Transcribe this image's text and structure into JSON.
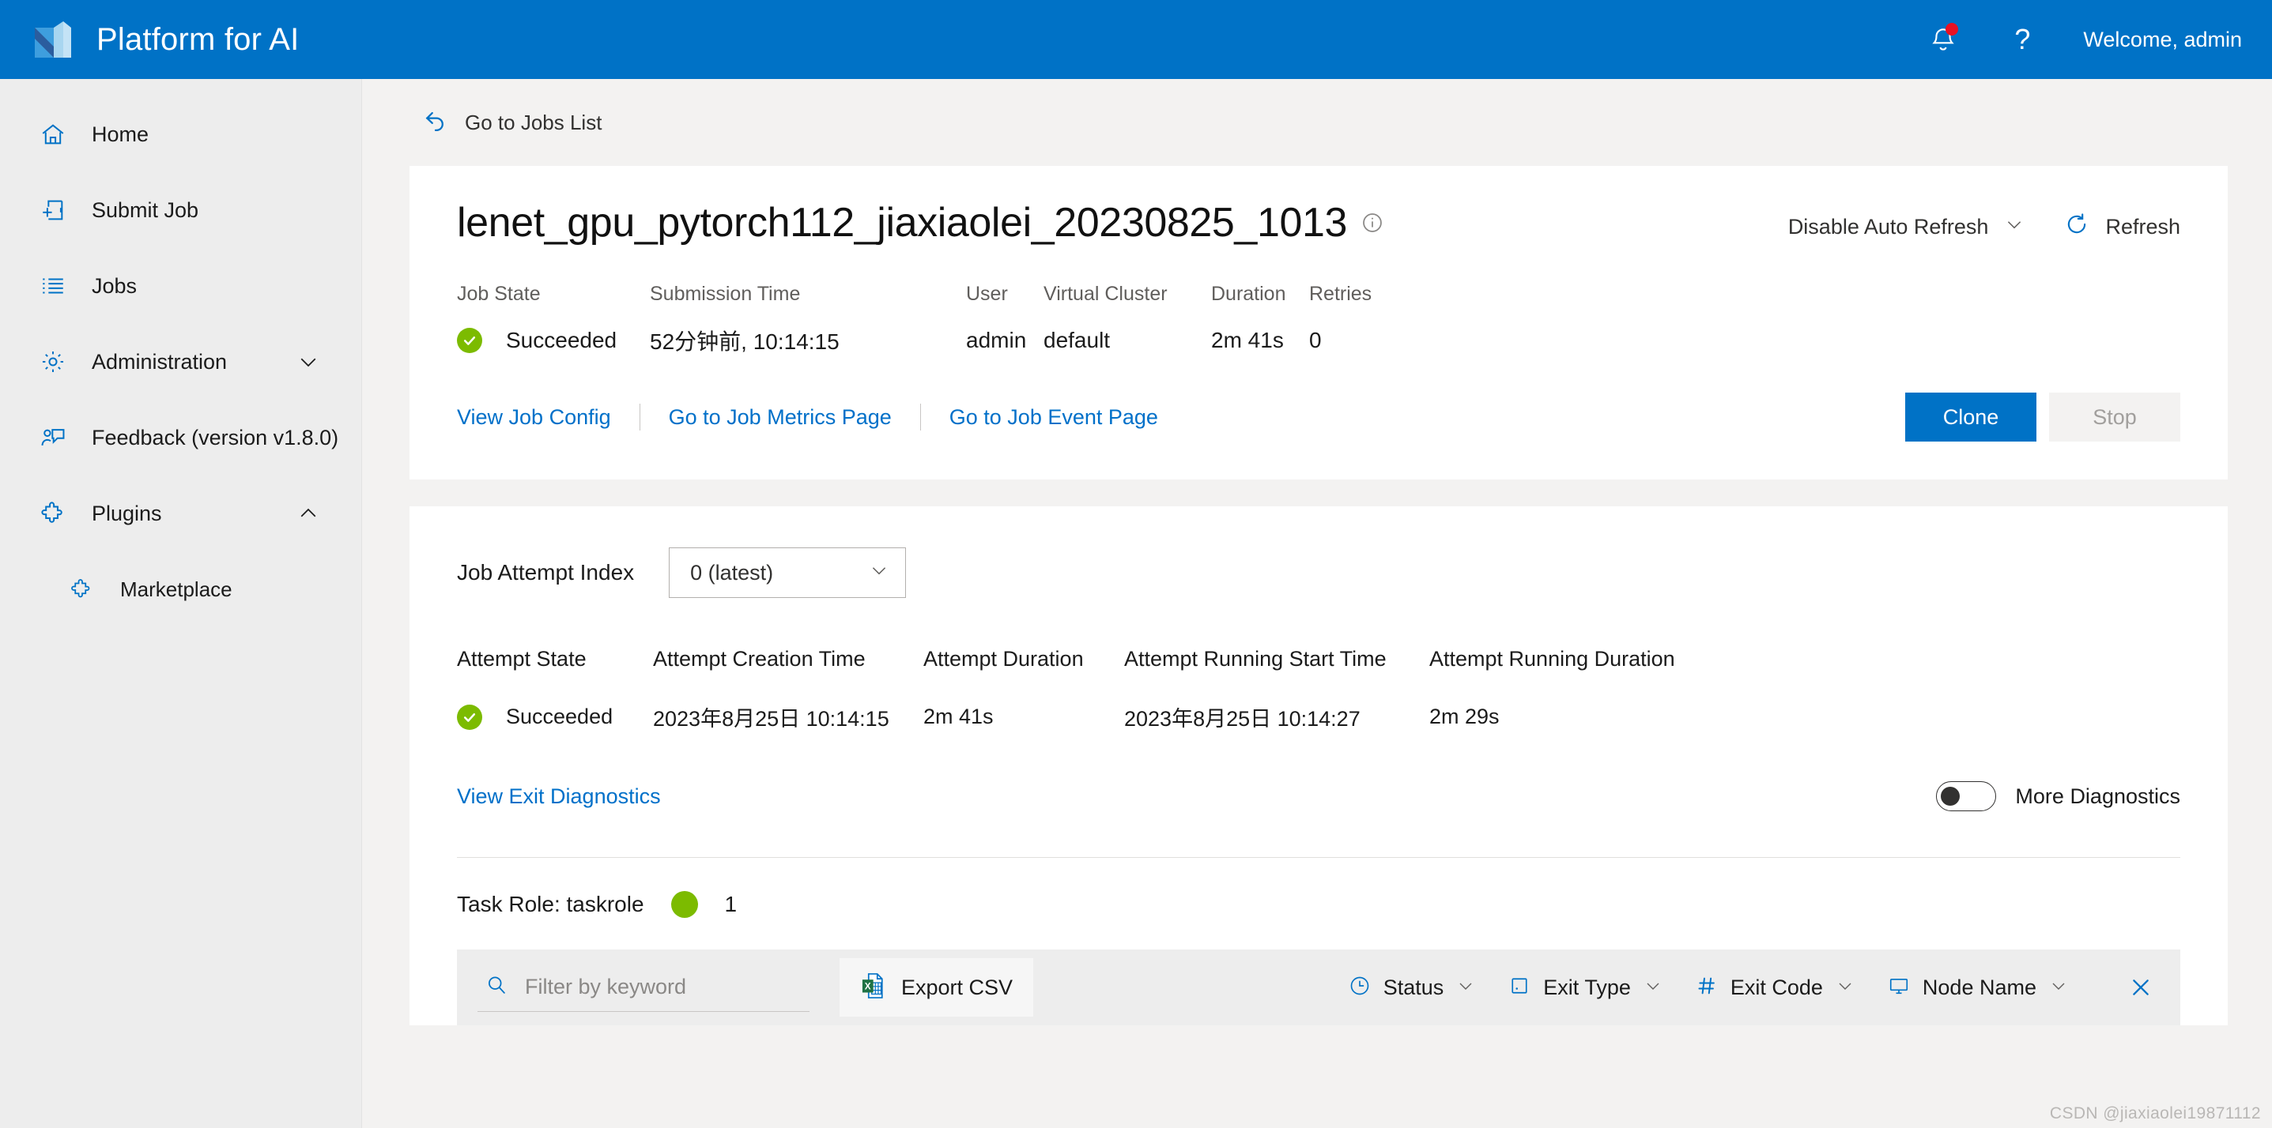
{
  "header": {
    "brand_title": "Platform for AI",
    "logo_name": "platform-logo",
    "notifications_icon": "bell-icon",
    "help_icon": "question-mark-icon",
    "welcome": "Welcome, admin",
    "accent_color": "#0072c6",
    "badge_color": "#e81123"
  },
  "sidebar": {
    "items": [
      {
        "label": "Home",
        "icon": "home-icon",
        "name": "home",
        "expandable": false,
        "sub": false
      },
      {
        "label": "Submit Job",
        "icon": "submit-job-icon",
        "name": "submit-job",
        "expandable": false,
        "sub": false
      },
      {
        "label": "Jobs",
        "icon": "jobs-list-icon",
        "name": "jobs",
        "expandable": false,
        "sub": false
      },
      {
        "label": "Administration",
        "icon": "gear-icon",
        "name": "administration",
        "expandable": true,
        "chevron": "chevron-down-icon",
        "sub": false
      },
      {
        "label": "Feedback (version v1.8.0)",
        "icon": "feedback-icon",
        "name": "feedback",
        "expandable": false,
        "sub": false
      },
      {
        "label": "Plugins",
        "icon": "puzzle-icon",
        "name": "plugins",
        "expandable": true,
        "chevron": "chevron-up-icon",
        "sub": false
      },
      {
        "label": "Marketplace",
        "icon": "puzzle-icon",
        "name": "marketplace",
        "expandable": false,
        "sub": true
      }
    ]
  },
  "breadcrumb": {
    "back_label": "Go to Jobs List",
    "back_icon": "back-arrow-icon"
  },
  "job": {
    "title": "lenet_gpu_pytorch112_jiaxiaolei_20230825_1013",
    "info_icon": "info-icon",
    "auto_refresh_label": "Disable Auto Refresh",
    "refresh_label": "Refresh",
    "meta_headers": [
      "Job State",
      "Submission Time",
      "User",
      "Virtual Cluster",
      "Duration",
      "Retries"
    ],
    "state": "Succeeded",
    "submission_time": "52分钟前, 10:14:15",
    "user": "admin",
    "virtual_cluster": "default",
    "duration": "2m 41s",
    "retries": "0",
    "state_color": "#7cbb00",
    "links": [
      "View Job Config",
      "Go to Job Metrics Page",
      "Go to Job Event Page"
    ],
    "clone_label": "Clone",
    "stop_label": "Stop"
  },
  "attempt": {
    "index_label": "Job Attempt Index",
    "index_value": "0 (latest)",
    "headers": [
      "Attempt State",
      "Attempt Creation Time",
      "Attempt Duration",
      "Attempt Running Start Time",
      "Attempt Running Duration"
    ],
    "state": "Succeeded",
    "creation_time": "2023年8月25日 10:14:15",
    "duration": "2m 41s",
    "running_start_time": "2023年8月25日 10:14:27",
    "running_duration": "2m 29s",
    "exit_diagnostics_label": "View Exit Diagnostics",
    "more_diagnostics_label": "More Diagnostics",
    "more_diagnostics_on": false
  },
  "taskrole": {
    "label": "Task Role: taskrole",
    "count": "1",
    "dot_color": "#7cbb00"
  },
  "toolbar": {
    "search_placeholder": "Filter by keyword",
    "search_value": "",
    "search_icon": "search-icon",
    "export_label": "Export CSV",
    "export_icon": "excel-file-icon",
    "filters": [
      {
        "label": "Status",
        "icon": "clock-icon"
      },
      {
        "label": "Exit Type",
        "icon": "square-icon"
      },
      {
        "label": "Exit Code",
        "icon": "hash-icon"
      },
      {
        "label": "Node Name",
        "icon": "monitor-icon"
      }
    ],
    "close_icon": "close-icon"
  },
  "watermark": "CSDN @jiaxiaolei19871112"
}
